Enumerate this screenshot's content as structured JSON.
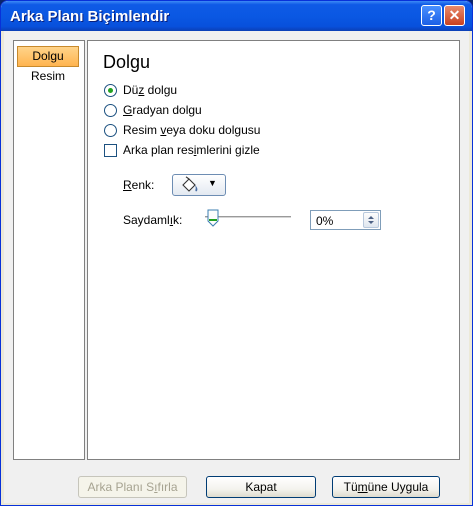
{
  "window": {
    "title": "Arka Planı Biçimlendir",
    "help_glyph": "?",
    "close_glyph": "✕"
  },
  "sidebar": {
    "items": [
      {
        "label": "Dolgu",
        "active": true
      },
      {
        "label": "Resim",
        "active": false
      }
    ]
  },
  "panel": {
    "heading": "Dolgu",
    "options": {
      "solid": {
        "pre": "Dü",
        "key": "z",
        "post": " dolgu",
        "checked": true
      },
      "gradient": {
        "pre": "",
        "key": "G",
        "post": "radyan dolgu",
        "checked": false
      },
      "picture": {
        "pre": "Resim ",
        "key": "v",
        "post": "eya doku dolgusu",
        "checked": false
      }
    },
    "hide_background": {
      "pre": "Arka plan res",
      "key": "i",
      "post": "mlerini gizle",
      "checked": false
    },
    "color": {
      "key": "R",
      "post": "enk:",
      "swatch": "#000000"
    },
    "transparency": {
      "pre": "Saydaml",
      "key": "ı",
      "post": "k:",
      "value_percent": 0,
      "value_text": "0%"
    }
  },
  "footer": {
    "reset": {
      "pre": "Arka Planı S",
      "key": "ı",
      "post": "fırla",
      "enabled": false
    },
    "close": {
      "label": "Kapat"
    },
    "apply_all": {
      "pre": "Tü",
      "key": "m",
      "post": "üne Uygula"
    }
  },
  "colors": {
    "title_bar": "#0a58e3",
    "active_tab": "#ffc46b",
    "radio_dot": "#21a121"
  }
}
